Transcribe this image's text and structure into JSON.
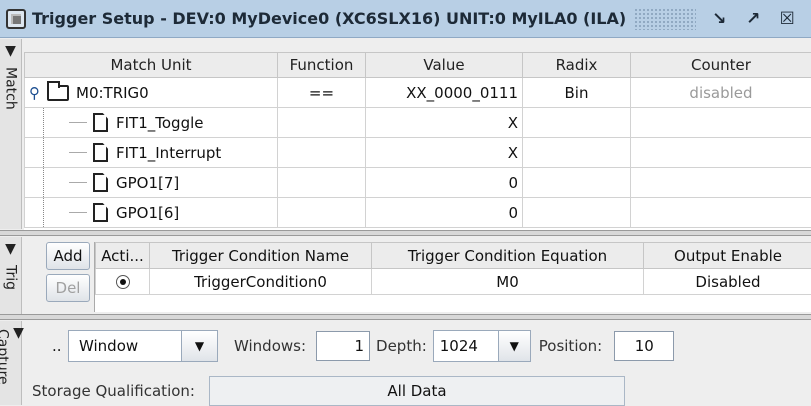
{
  "window": {
    "title": "Trigger Setup - DEV:0 MyDevice0 (XC6SLX16) UNIT:0 MyILA0 (ILA)",
    "icon": "trigger-icon",
    "buttons": [
      "minimize-icon",
      "maximize-icon",
      "close-icon"
    ]
  },
  "strips": {
    "match": "Match",
    "trig": "Trig",
    "capture": "Capture"
  },
  "match_table": {
    "columns": [
      "Match Unit",
      "Function",
      "Value",
      "Radix",
      "Counter"
    ],
    "root": {
      "name": "M0:TRIG0",
      "function": "==",
      "value": "XX_0000_0111",
      "radix": "Bin",
      "counter": "disabled"
    },
    "children": [
      {
        "name": "FIT1_Toggle",
        "value": "X"
      },
      {
        "name": "FIT1_Interrupt",
        "value": "X"
      },
      {
        "name": "GPO1[7]",
        "value": "0"
      },
      {
        "name": "GPO1[6]",
        "value": "0"
      }
    ]
  },
  "trigger": {
    "add_label": "Add",
    "del_label": "Del",
    "columns": [
      "Acti...",
      "Trigger Condition Name",
      "Trigger Condition Equation",
      "Output Enable"
    ],
    "rows": [
      {
        "active": true,
        "name": "TriggerCondition0",
        "equation": "M0",
        "output_enable": "Disabled"
      }
    ]
  },
  "capture": {
    "dots": "..",
    "mode": "Window",
    "windows_label": "Windows:",
    "windows_value": "1",
    "depth_label": "Depth:",
    "depth_value": "1024",
    "position_label": "Position:",
    "position_value": "10",
    "storage_label": "Storage Qualification:",
    "storage_value": "All Data"
  }
}
